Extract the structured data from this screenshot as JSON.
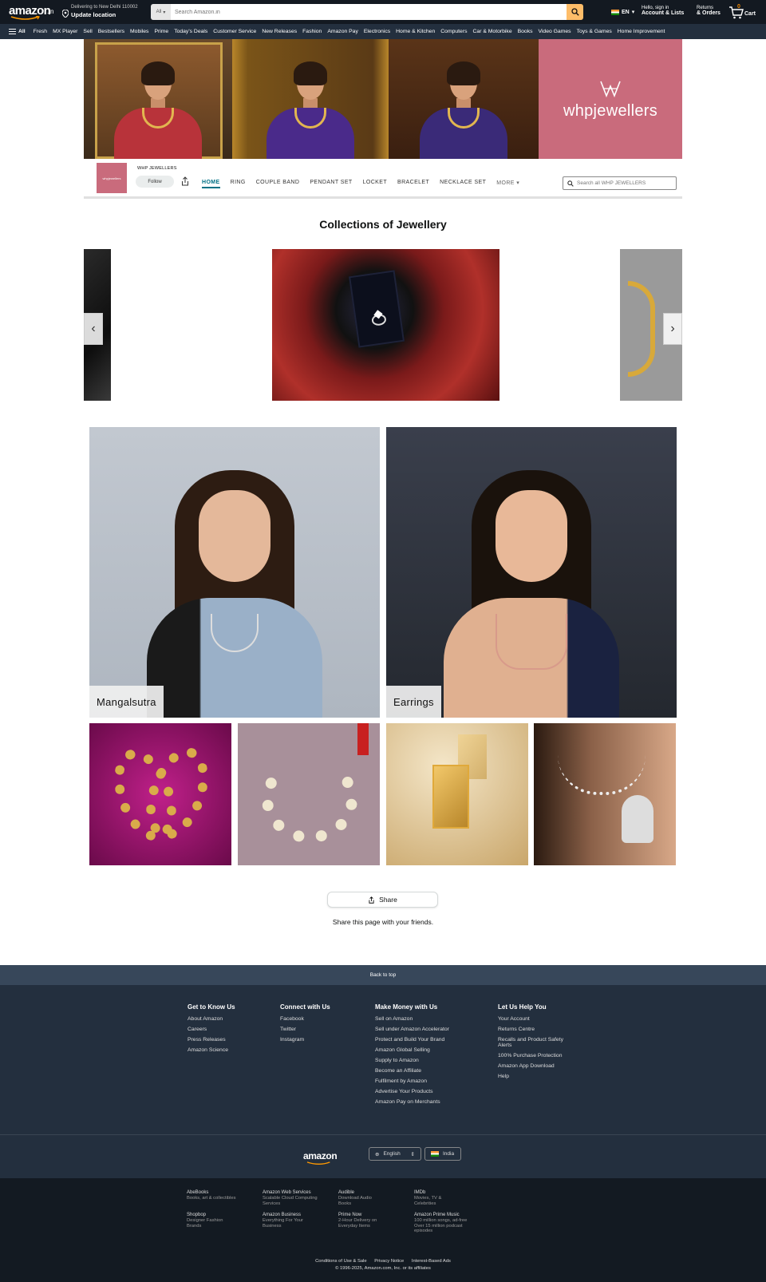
{
  "header": {
    "logo": "amazon",
    "logo_tld": ".in",
    "deliver_line1": "Delivering to New Delhi 110002",
    "deliver_line2": "Update location",
    "search_category": "All",
    "search_placeholder": "Search Amazon.in",
    "language": "EN",
    "account_line1": "Hello, sign in",
    "account_line2": "Account & Lists",
    "returns_line1": "Returns",
    "returns_line2": "& Orders",
    "cart_count": "0",
    "cart_label": "Cart"
  },
  "subnav": {
    "all_label": "All",
    "items": [
      "Fresh",
      "MX Player",
      "Sell",
      "Bestsellers",
      "Mobiles",
      "Prime",
      "Today's Deals",
      "Customer Service",
      "New Releases",
      "Fashion",
      "Amazon Pay",
      "Electronics",
      "Home & Kitchen",
      "Computers",
      "Car & Motorbike",
      "Books",
      "Video Games",
      "Toys & Games",
      "Home Improvement"
    ]
  },
  "hero": {
    "brand_wordmark": "whpjewellers"
  },
  "store": {
    "logo_text": "whpjewellers",
    "name": "WHP JEWELLERS",
    "follow_label": "Follow",
    "tabs": [
      "HOME",
      "RING",
      "COUPLE BAND",
      "PENDANT SET",
      "LOCKET",
      "BRACELET",
      "NECKLACE SET",
      "MORE"
    ],
    "active_tab": "HOME",
    "search_placeholder": "Search all WHP JEWELLERS"
  },
  "collections": {
    "title": "Collections of Jewellery"
  },
  "tiles": {
    "big": [
      "Mangalsutra",
      "Earrings"
    ]
  },
  "share": {
    "button_label": "Share",
    "caption": "Share this page with your friends."
  },
  "footer": {
    "back_to_top": "Back to top",
    "columns": [
      {
        "title": "Get to Know Us",
        "links": [
          "About Amazon",
          "Careers",
          "Press Releases",
          "Amazon Science"
        ]
      },
      {
        "title": "Connect with Us",
        "links": [
          "Facebook",
          "Twitter",
          "Instagram"
        ]
      },
      {
        "title": "Make Money with Us",
        "links": [
          "Sell on Amazon",
          "Sell under Amazon Accelerator",
          "Protect and Build Your Brand",
          "Amazon Global Selling",
          "Supply to Amazon",
          "Become an Affiliate",
          "Fulfilment by Amazon",
          "Advertise Your Products",
          "Amazon Pay on Merchants"
        ]
      },
      {
        "title": "Let Us Help You",
        "links": [
          "Your Account",
          "Returns Centre",
          "Recalls and Product Safety Alerts",
          "100% Purchase Protection",
          "Amazon App Download",
          "Help"
        ]
      }
    ],
    "logo": "amazon",
    "language": "English",
    "country": "India",
    "services": [
      {
        "title": "AbeBooks",
        "desc": "Books, art & collectibles"
      },
      {
        "title": "Amazon Web Services",
        "desc": "Scalable Cloud Computing Services"
      },
      {
        "title": "Audible",
        "desc": "Download Audio Books"
      },
      {
        "title": "IMDb",
        "desc": "Movies, TV & Celebrities"
      },
      {
        "title": "Shopbop",
        "desc": "Designer Fashion Brands"
      },
      {
        "title": "Amazon Business",
        "desc": "Everything For Your Business"
      },
      {
        "title": "Prime Now",
        "desc": "2-Hour Delivery on Everyday Items"
      },
      {
        "title": "Amazon Prime Music",
        "desc": "100 million songs, ad-free Over 15 million podcast episodes"
      }
    ],
    "legal_links": [
      "Conditions of Use & Sale",
      "Privacy Notice",
      "Interest-Based Ads"
    ],
    "copyright": "© 1996-2025, Amazon.com, Inc. or its affiliates"
  },
  "colors": {
    "nav_dark": "#131921",
    "nav_sub": "#232f3e",
    "search_button": "#febd69",
    "brand_pink": "#c96b7c",
    "active_tab": "#007185"
  }
}
